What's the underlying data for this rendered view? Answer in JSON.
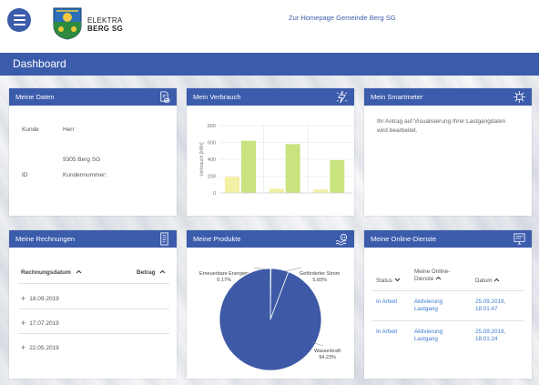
{
  "header": {
    "logo_line1": "ELEKTRA",
    "logo_line2": "BERG SG",
    "home_link": "Zur Homepage Gemeinde Berg SG"
  },
  "page_title": "Dashboard",
  "colors": {
    "primary": "#3b5bab",
    "bar_green": "#c9e37f",
    "bar_yellow": "#f2f0a2",
    "link": "#3b7bd0",
    "pie_blue": "#3e5aa6"
  },
  "meine_daten": {
    "title": "Meine Daten",
    "icon": "document-coins-icon",
    "kunde_label": "Kunde",
    "kunde_value": "Herr",
    "address": "9305 Berg SG",
    "id_label": "ID",
    "id_value": "Kundennummer:"
  },
  "verbrauch": {
    "title": "Mein Verbrauch",
    "icon": "lightning-icon"
  },
  "smartmeter": {
    "title": "Mein Smartmeter",
    "icon": "meter-icon",
    "text": "Ihr Antrag auf Visualisierung Ihrer Lastgangdaten wird bearbeitet."
  },
  "rechnungen": {
    "title": "Meine Rechnungen",
    "icon": "invoice-icon",
    "col_date": "Rechnungsdatum",
    "col_amount": "Betrag",
    "rows": [
      "18.09.2019",
      "17.07.2019",
      "22.05.2019"
    ]
  },
  "produkte": {
    "title": "Meine Produkte",
    "icon": "water-plug-icon"
  },
  "online_dienste": {
    "title": "Meine Online-Dienste",
    "icon": "monitor-icon",
    "col_status": "Status",
    "col_dienste": "Meine Online-Dienste",
    "col_datum": "Datum",
    "rows": [
      {
        "status": "In Arbeit",
        "dienst": "Aktivierung Lastgang",
        "datum": "25.09.2019, 18:01:47"
      },
      {
        "status": "In Arbeit",
        "dienst": "Aktivierung Lastgang",
        "datum": "25.09.2019, 18:01:24"
      }
    ]
  },
  "chart_data": [
    {
      "type": "bar",
      "title": "",
      "ylabel": "Verbrauch [kWh]",
      "ylim": [
        0,
        800
      ],
      "yticks": [
        "800",
        "600",
        "400",
        "200",
        "0"
      ],
      "categories": [
        "1",
        "2",
        "3"
      ],
      "series": [
        {
          "values": [
            190,
            50,
            40
          ],
          "color": "#f2f0a2"
        },
        {
          "values": [
            620,
            580,
            390
          ],
          "color": "#c9e37f"
        }
      ],
      "grid": true
    },
    {
      "type": "pie",
      "slices": [
        {
          "label": "Erneuerbare Energien",
          "pct_text": "0.17%",
          "value": 0.17
        },
        {
          "label": "Geförderter Strom",
          "pct_text": "5.60%",
          "value": 5.6
        },
        {
          "label": "Wasserkraft",
          "pct_text": "94.23%",
          "value": 94.23
        }
      ]
    }
  ]
}
